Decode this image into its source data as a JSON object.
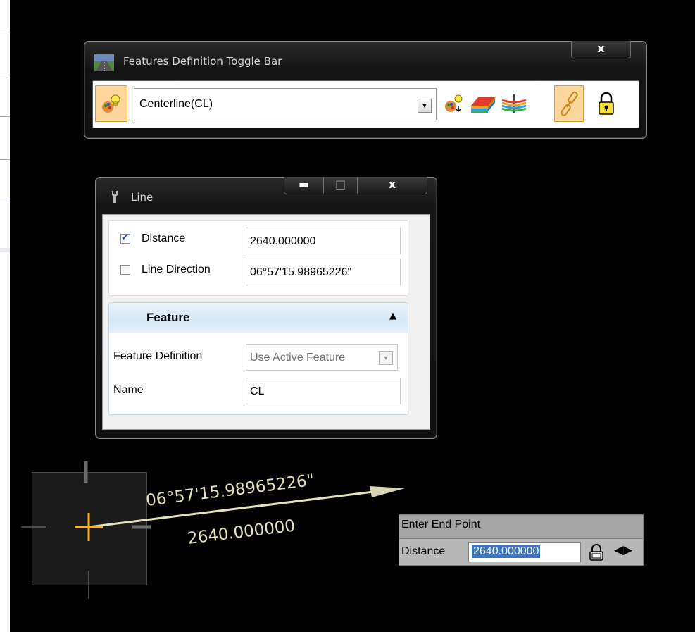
{
  "toggle_bar": {
    "title": "Features Definition Toggle Bar",
    "close_label": "x",
    "selected_feature": "Centerline(CL)",
    "tools": [
      "feature-definition-icon",
      "feature-match-icon",
      "terrain-surface-icon",
      "corridor-template-icon",
      "linear-link-icon",
      "lock-icon"
    ]
  },
  "line_dialog": {
    "title": "Line",
    "distance_label": "Distance",
    "distance_checked": true,
    "distance_value": "2640.000000",
    "direction_label": "Line Direction",
    "direction_checked": false,
    "direction_value": "06°57'15.98965226\"",
    "feature_section": "Feature",
    "feature_definition_label": "Feature Definition",
    "feature_definition_value": "Use Active Feature",
    "name_label": "Name",
    "name_value": "CL"
  },
  "canvas": {
    "bearing_text": "06°57'15.98965226\"",
    "distance_text": "2640.000000",
    "line_color": "#e6e2ba",
    "cursor_color": "#ffb020"
  },
  "prompt": {
    "title": "Enter End Point",
    "distance_label": "Distance",
    "distance_value": "2640.000000"
  }
}
